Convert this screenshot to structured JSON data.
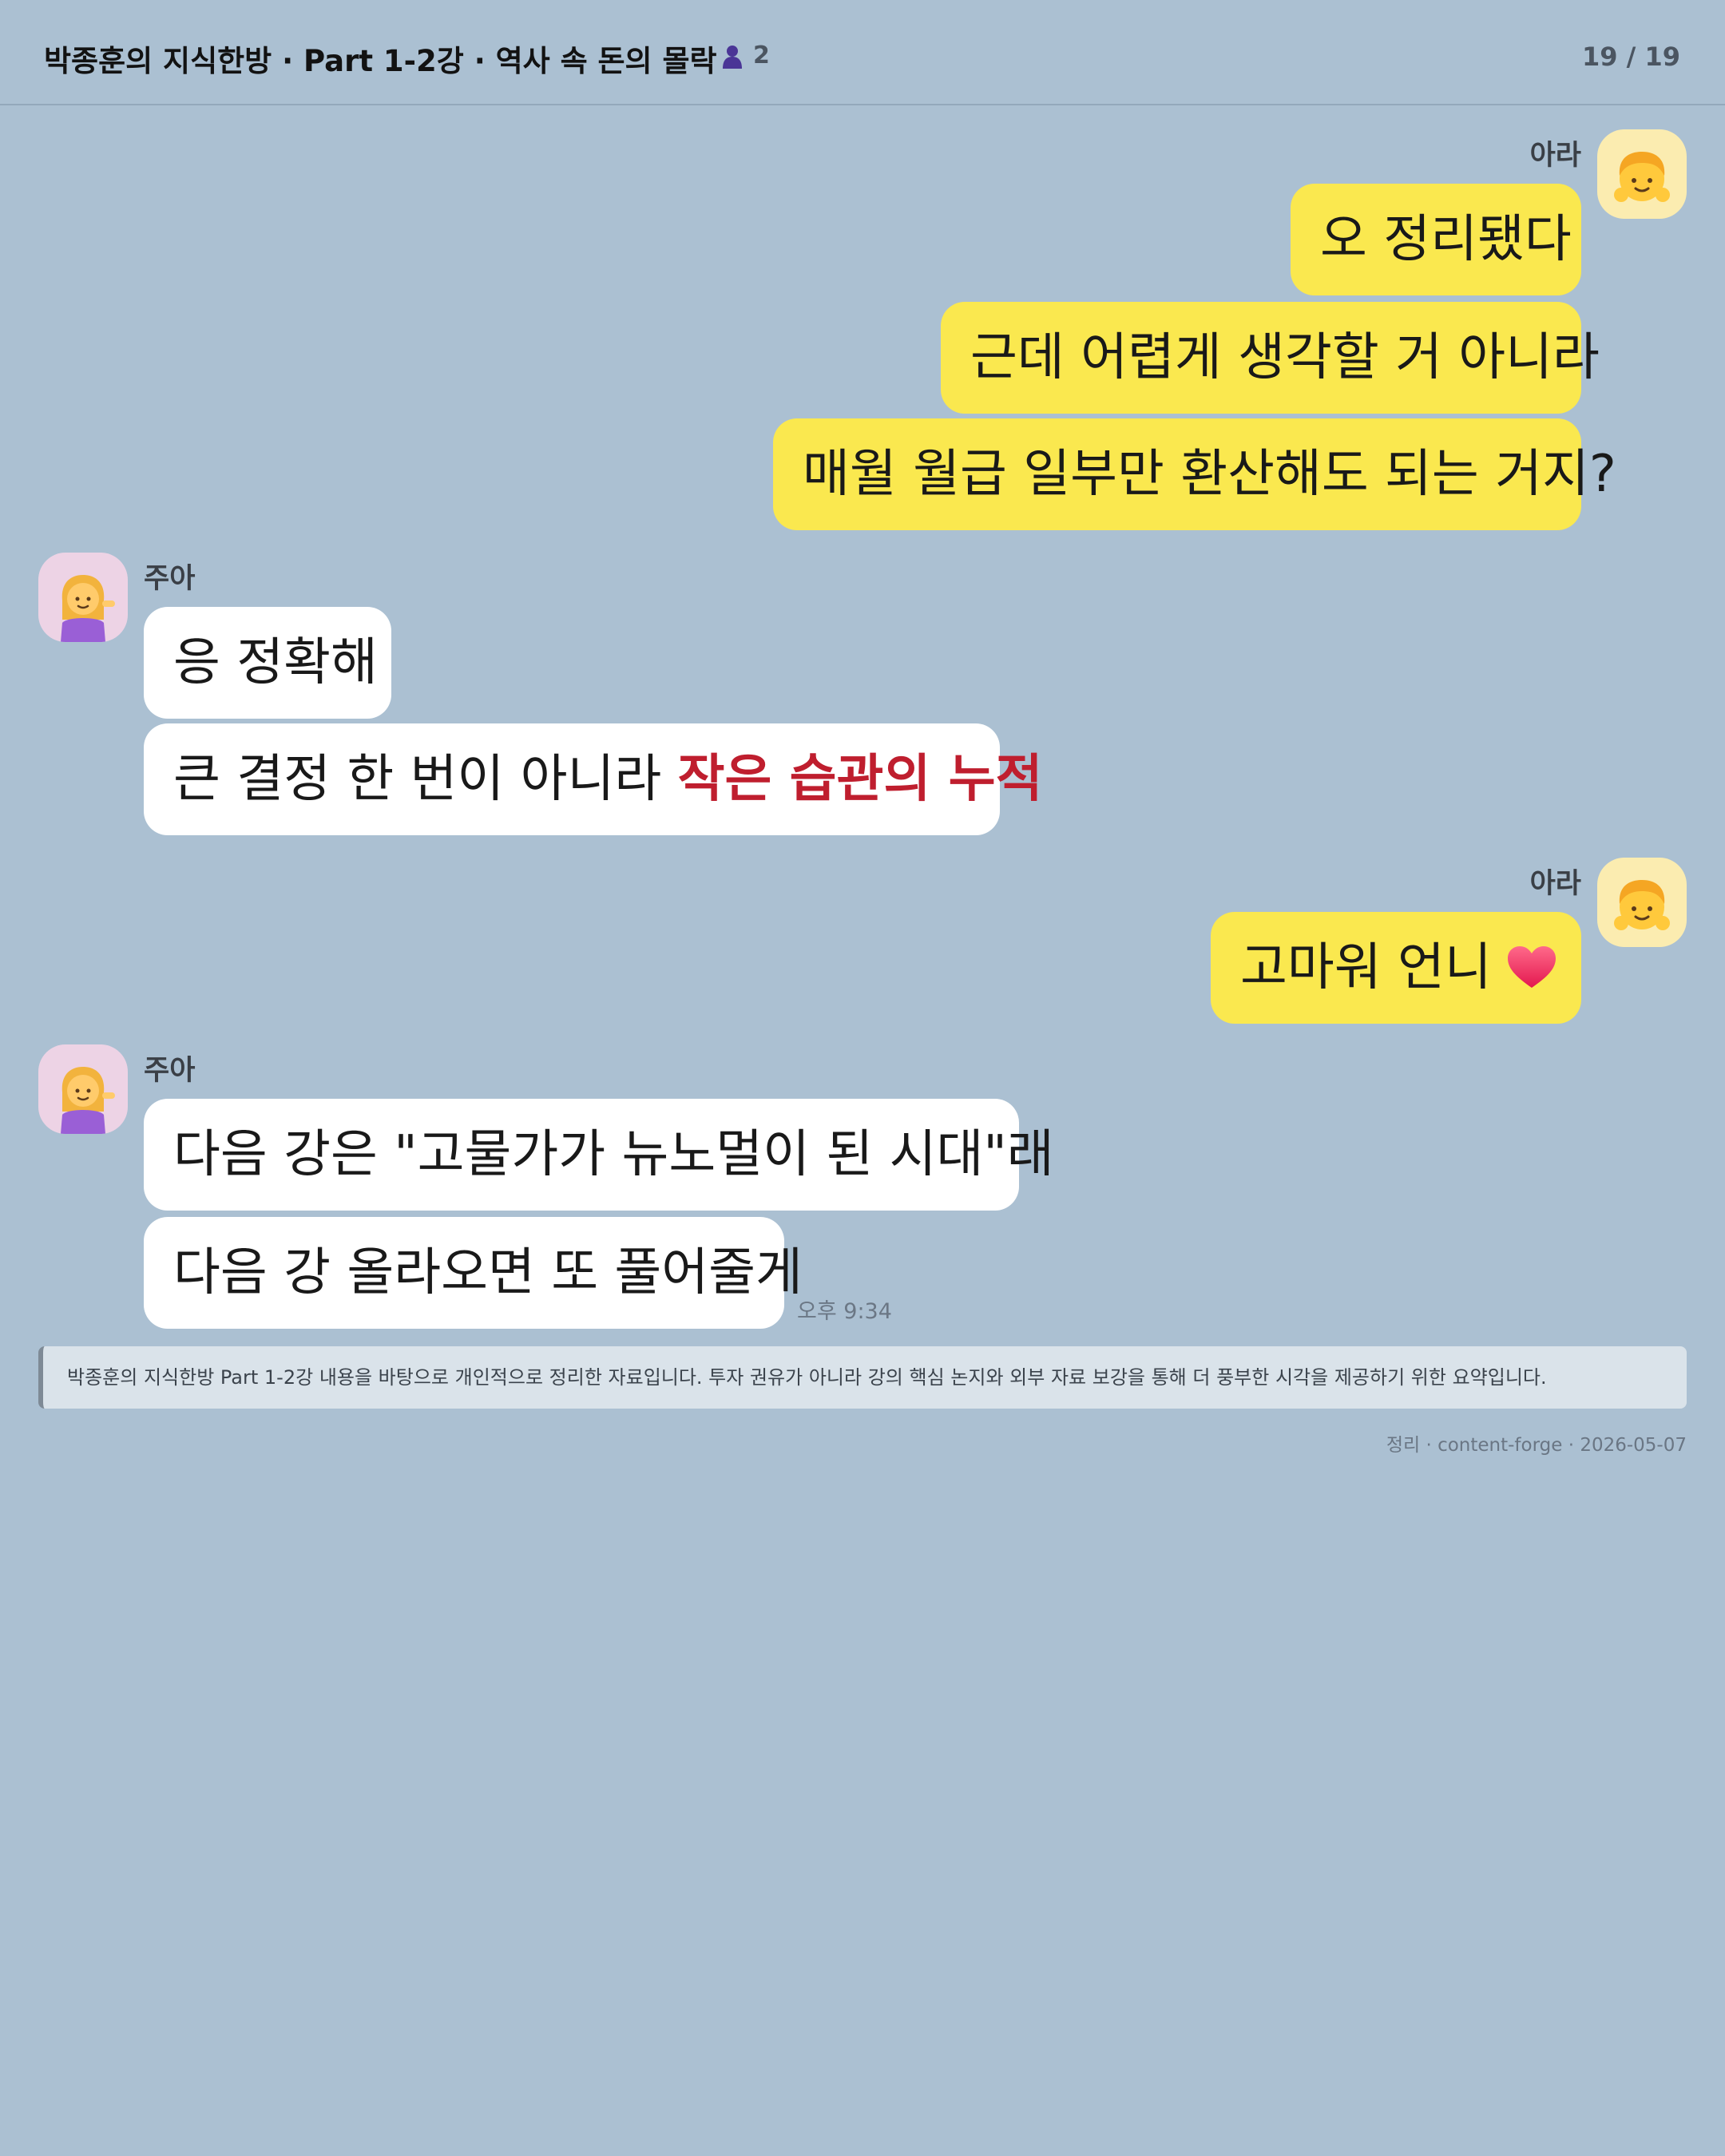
{
  "header": {
    "title": "박종훈의 지식한방 · Part 1-2강 · 역사 속 돈의 몰락",
    "member_count": "2",
    "page_indicator": "19 / 19"
  },
  "messages": [
    {
      "sender": "아라",
      "side": "right",
      "avatar": "ara-avatar-icon",
      "bubbles": [
        "오 정리됐다",
        "근데 어렵게 생각할 거 아니라",
        "매월 월급 일부만 환산해도 되는 거지?"
      ]
    },
    {
      "sender": "주아",
      "side": "left",
      "avatar": "jua-avatar-icon",
      "bubbles": [
        "응 정확해"
      ],
      "bubble2": {
        "text": "큰 결정 한 번이 아니라 ",
        "highlight": "작은 습관의 누적"
      }
    },
    {
      "sender": "아라",
      "side": "right",
      "avatar": "ara-avatar-icon",
      "bubbles": [
        "고마워 언니"
      ],
      "emoji": "heart-icon"
    },
    {
      "sender": "주아",
      "side": "left",
      "avatar": "jua-avatar-icon",
      "bubbles": [
        "다음 강은 \"고물가가 뉴노멀이 된 시대\"래",
        "다음 강 올라오면 또 풀어줄게"
      ],
      "time": "오후 9:34"
    }
  ],
  "notice": "박종훈의 지식한방 Part 1-2강 내용을 바탕으로 개인적으로 정리한 자료입니다. 투자 권유가 아니라 강의 핵심 논지와 외부 자료 보강을 통해 더 풍부한 시각을 제공하기 위한 요약입니다.",
  "credit": "정리 · content-forge · 2026-05-07",
  "colors": {
    "background": "#abc0d2",
    "my_bubble": "#fae84f",
    "their_bubble": "#ffffff",
    "highlight": "#bf1e2e"
  }
}
